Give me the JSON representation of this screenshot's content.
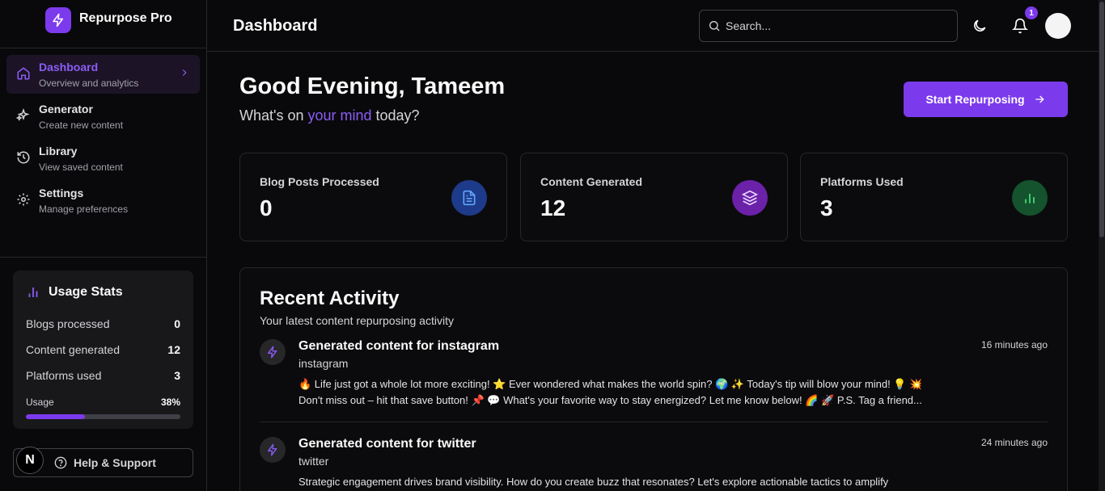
{
  "brand": {
    "name": "Repurpose Pro"
  },
  "sidebar": {
    "items": [
      {
        "title": "Dashboard",
        "subtitle": "Overview and analytics",
        "icon": "home-icon",
        "active": true
      },
      {
        "title": "Generator",
        "subtitle": "Create new content",
        "icon": "sparkles-icon",
        "active": false
      },
      {
        "title": "Library",
        "subtitle": "View saved content",
        "icon": "history-icon",
        "active": false
      },
      {
        "title": "Settings",
        "subtitle": "Manage preferences",
        "icon": "gear-icon",
        "active": false
      }
    ],
    "usage": {
      "title": "Usage Stats",
      "rows": [
        {
          "label": "Blogs processed",
          "value": "0"
        },
        {
          "label": "Content generated",
          "value": "12"
        },
        {
          "label": "Platforms used",
          "value": "3"
        }
      ],
      "bar_label": "Usage",
      "bar_value": "38%",
      "bar_fraction": 0.38
    },
    "help_label": "Help & Support",
    "badge_letter": "N"
  },
  "header": {
    "title": "Dashboard",
    "search_placeholder": "Search...",
    "notification_count": "1"
  },
  "main": {
    "greeting": "Good Evening, Tameem",
    "subtitle_pre": "What's on ",
    "subtitle_highlight": "your mind",
    "subtitle_post": " today?",
    "cta_label": "Start Repurposing",
    "stats": [
      {
        "label": "Blog Posts Processed",
        "value": "0",
        "icon": "file-text-icon",
        "color": "#1e3a8a",
        "icon_color": "#60a5fa"
      },
      {
        "label": "Content Generated",
        "value": "12",
        "icon": "layers-icon",
        "color": "#6b21a8",
        "icon_color": "#d8b4fe"
      },
      {
        "label": "Platforms Used",
        "value": "3",
        "icon": "bar-chart-icon",
        "color": "#14532d",
        "icon_color": "#4ade80"
      }
    ],
    "activity": {
      "title": "Recent Activity",
      "subtitle": "Your latest content repurposing activity",
      "items": [
        {
          "heading": "Generated content for instagram",
          "platform": "instagram",
          "time": "16 minutes ago",
          "line1": "🔥 Life just got a whole lot more exciting! ⭐ Ever wondered what makes the world spin? 🌍 ✨ Today's tip will blow your mind! 💡 💥",
          "line2": "Don't miss out – hit that save button! 📌 💬 What's your favorite way to stay energized? Let me know below! 🌈 🚀 P.S. Tag a friend..."
        },
        {
          "heading": "Generated content for twitter",
          "platform": "twitter",
          "time": "24 minutes ago",
          "line1": "Strategic engagement drives brand visibility. How do you create buzz that resonates? Let's explore actionable tactics to amplify",
          "line2": ""
        }
      ]
    }
  },
  "colors": {
    "accent": "#7c3aed",
    "accent_text": "#8b5cf6",
    "background": "#09090b",
    "border": "#27272a"
  }
}
